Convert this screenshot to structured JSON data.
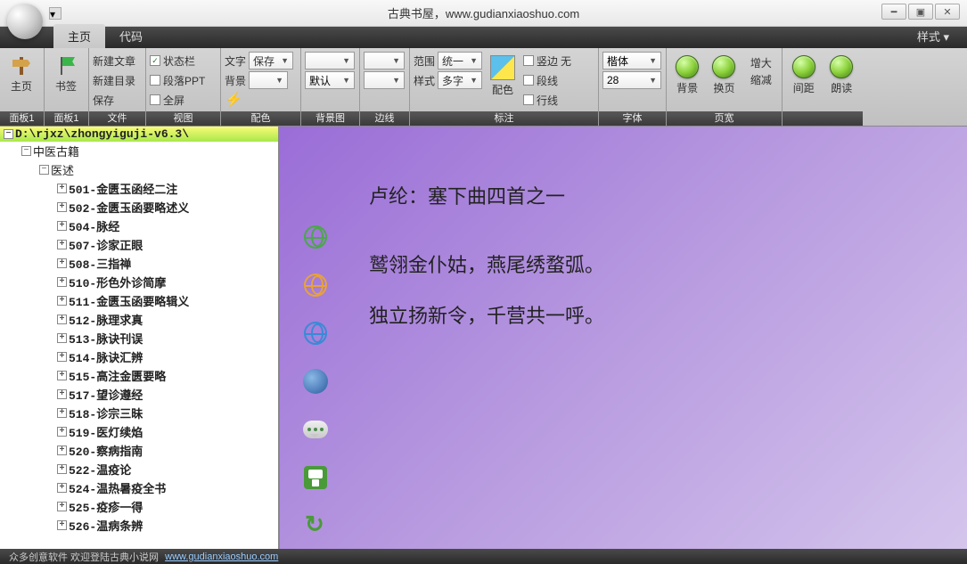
{
  "title": "古典书屋，www.gudianxiaoshuo.com",
  "tabs": {
    "home": "主页",
    "code": "代码",
    "style": "样式"
  },
  "ribbon": {
    "g1": {
      "label": "面板1",
      "home": "主页"
    },
    "g2": {
      "label": "面板1",
      "bookmark": "书签"
    },
    "g3": {
      "label": "文件",
      "newArticle": "新建文章",
      "newDir": "新建目录",
      "save": "保存"
    },
    "g4": {
      "label": "视图",
      "statusbar": "状态栏",
      "paraPPT": "段落PPT",
      "fullscreen": "全屏"
    },
    "g5": {
      "label": "配色",
      "text": "文字",
      "bg": "背景",
      "saveOpt": "保存"
    },
    "g6": {
      "label": "背景图",
      "default": "默认"
    },
    "g7": {
      "label": "边线"
    },
    "g8": {
      "label": "标注",
      "scope": "范围",
      "unify": "统一",
      "style": "样式",
      "multi": "多字",
      "color": "配色",
      "vert": "竖边",
      "none": "无",
      "segline": "段线",
      "rowline": "行线"
    },
    "g9": {
      "label": "字体",
      "font": "楷体",
      "size": "28"
    },
    "g10": {
      "label": "页宽",
      "bg": "背景",
      "flip": "换页",
      "zoomIn": "增大",
      "zoomOut": "缩减"
    },
    "g11": {
      "spacing": "间距",
      "read": "朗读"
    }
  },
  "tree": {
    "root": "D:\\rjxz\\zhongyiguji-v6.3\\",
    "n1": "中医古籍",
    "n2": "医述",
    "items": [
      "501-金匮玉函经二注",
      "502-金匮玉函要略述义",
      "504-脉经",
      "507-诊家正眼",
      "508-三指禅",
      "510-形色外诊简摩",
      "511-金匮玉函要略辑义",
      "512-脉理求真",
      "513-脉诀刊误",
      "514-脉诀汇辨",
      "515-高注金匮要略",
      "517-望诊遵经",
      "518-诊宗三昧",
      "519-医灯续焰",
      "520-察病指南",
      "522-温疫论",
      "524-温热暑疫全书",
      "525-疫疹一得",
      "526-温病条辨"
    ]
  },
  "poem": {
    "title": "卢纶：塞下曲四首之一",
    "l1": "鹫翎金仆姑，燕尾绣蝥弧。",
    "l2": "独立扬新令，千营共一呼。"
  },
  "status": {
    "text": "众多创意软件 欢迎登陆古典小说网",
    "url": "www.gudianxiaoshuo.com"
  }
}
